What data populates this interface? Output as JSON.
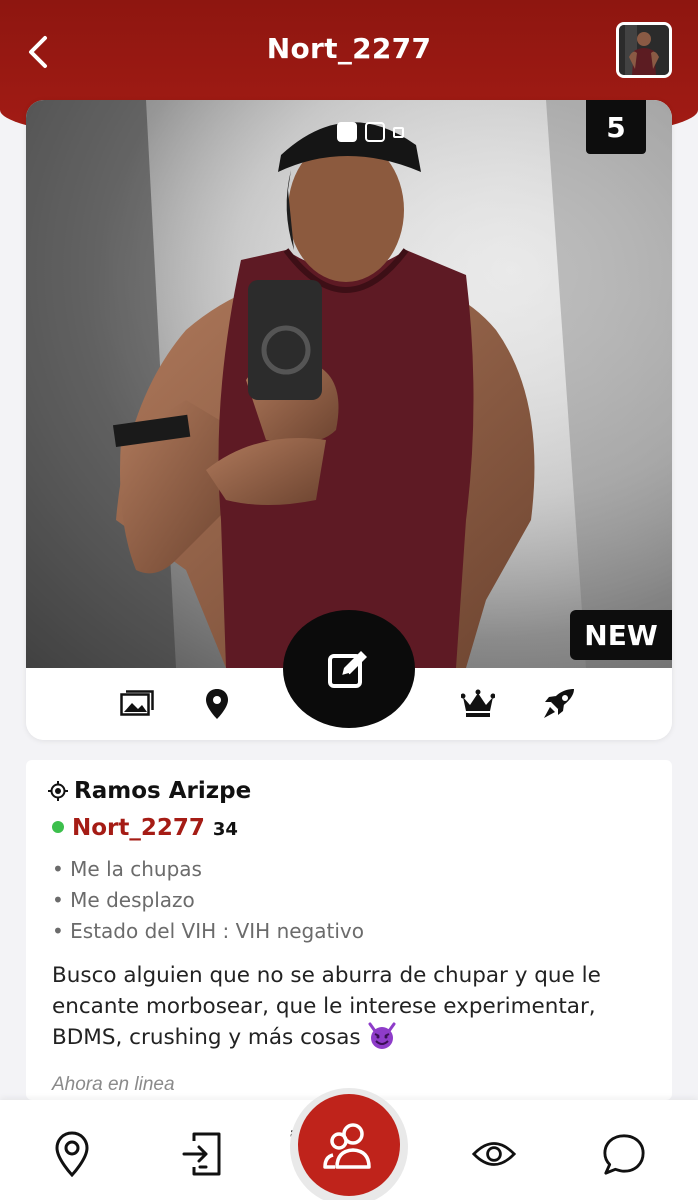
{
  "header": {
    "title": "Nort_2277",
    "back_icon": "chevron-left-icon",
    "avatar": "profile-avatar-thumbnail",
    "color": "#a51c15"
  },
  "photo": {
    "count": "5",
    "badge": "NEW",
    "pager": {
      "pages": 3,
      "active": 0
    }
  },
  "photo_actions": {
    "icons": [
      "photos-icon",
      "map-pin-icon",
      "edit-icon",
      "crown-icon",
      "rocket-icon"
    ]
  },
  "profile": {
    "location": "Ramos Arizpe",
    "username": "Nort_2277",
    "age": "34",
    "online_color": "#3cbf4c",
    "attributes": [
      "Me la chupas",
      "Me desplazo",
      "Estado del VIH : VIH negativo"
    ],
    "bio": "Busco alguien que no se aburra de chupar y que le encante morbosear, que le interese experimentar, BDMS, crushing y más cosas",
    "bio_emoji": "smiling-devil-emoji",
    "last_seen": "Ahora en linea"
  },
  "bottom_nav": {
    "items": [
      "map-pin-icon",
      "login-icon",
      "people-icon",
      "eye-icon",
      "chat-bubble-icon"
    ],
    "overlap_char": "a",
    "fab_color": "#bf231b"
  }
}
